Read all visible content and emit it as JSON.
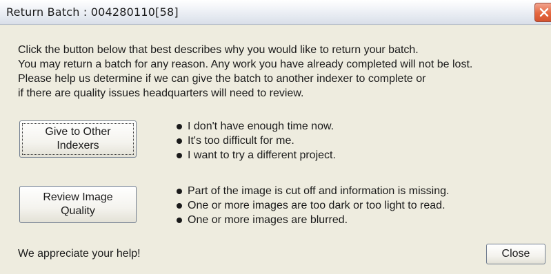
{
  "window": {
    "title": "Return Batch : 004280110[58]",
    "close_icon": "close-x-icon"
  },
  "intro": [
    "Click the button below that best describes why you would like to return your batch.",
    "You may return a batch for any reason. Any work you have already completed will not be lost.",
    "Please help us determine if we can give the batch to another indexer to complete or",
    "if there are quality issues headquarters will need to review."
  ],
  "options": {
    "give": {
      "button_label": "Give to Other\nIndexers",
      "reasons": [
        "I don't have enough time now.",
        "It's too difficult for me.",
        "I want to try a different project."
      ]
    },
    "review": {
      "button_label": "Review Image\nQuality",
      "reasons": [
        "Part of the image is cut off and information is missing.",
        "One or more images are too dark or too light to read.",
        "One or more images are blurred."
      ]
    }
  },
  "footer": {
    "thanks": "We appreciate your help!",
    "close_label": "Close"
  },
  "colors": {
    "close_button_red": "#e5673f",
    "dialog_background": "#eeecdf"
  }
}
